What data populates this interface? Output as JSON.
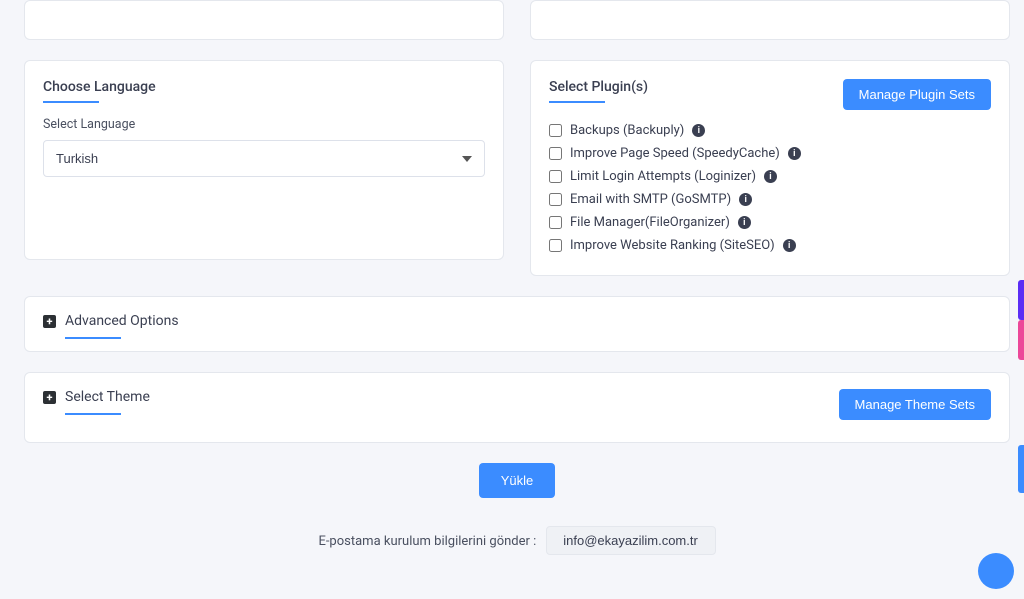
{
  "language_card": {
    "title": "Choose Language",
    "label": "Select Language",
    "selected": "Turkish"
  },
  "plugins_card": {
    "title": "Select Plugin(s)",
    "manage_button": "Manage Plugin Sets",
    "items": [
      {
        "label": "Backups (Backuply)"
      },
      {
        "label": "Improve Page Speed (SpeedyCache)"
      },
      {
        "label": "Limit Login Attempts (Loginizer)"
      },
      {
        "label": "Email with SMTP (GoSMTP)"
      },
      {
        "label": "File Manager(FileOrganizer)"
      },
      {
        "label": "Improve Website Ranking (SiteSEO)"
      }
    ]
  },
  "advanced_toggle": {
    "title": "Advanced Options"
  },
  "theme_toggle": {
    "title": "Select Theme",
    "manage_button": "Manage Theme Sets"
  },
  "install_button": "Yükle",
  "email_row": {
    "label": "E-postama kurulum bilgilerini gönder :",
    "value": "info@ekayazilim.com.tr"
  }
}
